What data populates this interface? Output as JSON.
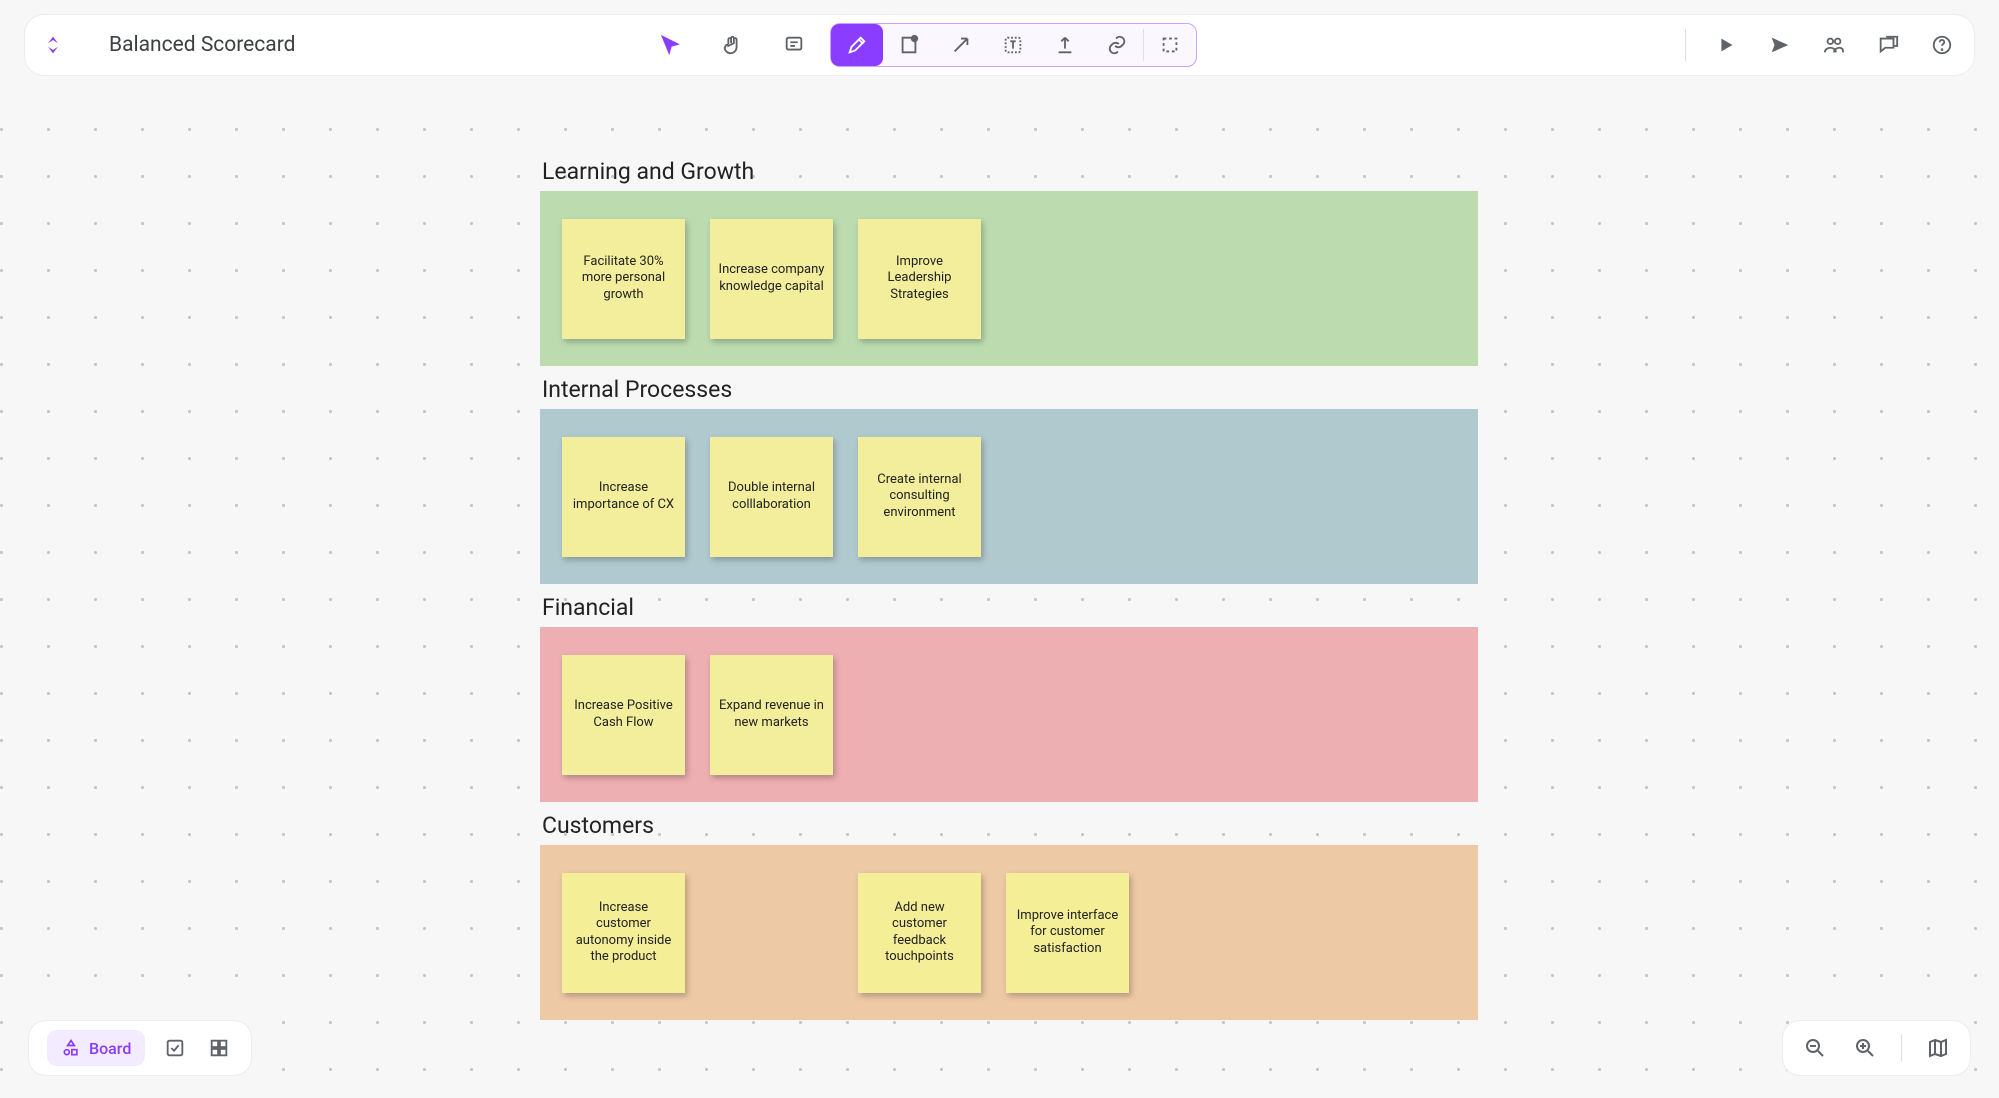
{
  "title": "Balanced Scorecard",
  "bottom": {
    "board_label": "Board"
  },
  "sections": [
    {
      "title": "Learning and Growth",
      "color": "green",
      "notes": [
        "Facilitate 30% more personal growth",
        "Increase company knowledge capital",
        "Improve Leadership Strategies"
      ]
    },
    {
      "title": "Internal Processes",
      "color": "blue",
      "notes": [
        "Increase importance of CX",
        "Double internal colllaboration",
        "Create internal consulting environment"
      ]
    },
    {
      "title": "Financial",
      "color": "red",
      "notes": [
        "Increase Positive Cash Flow",
        "Expand revenue in new markets"
      ]
    },
    {
      "title": "Customers",
      "color": "orange",
      "notes": [
        "Increase customer autonomy inside the product",
        "",
        "Add new customer feedback touchpoints",
        "Improve interface for customer satisfaction"
      ]
    }
  ]
}
